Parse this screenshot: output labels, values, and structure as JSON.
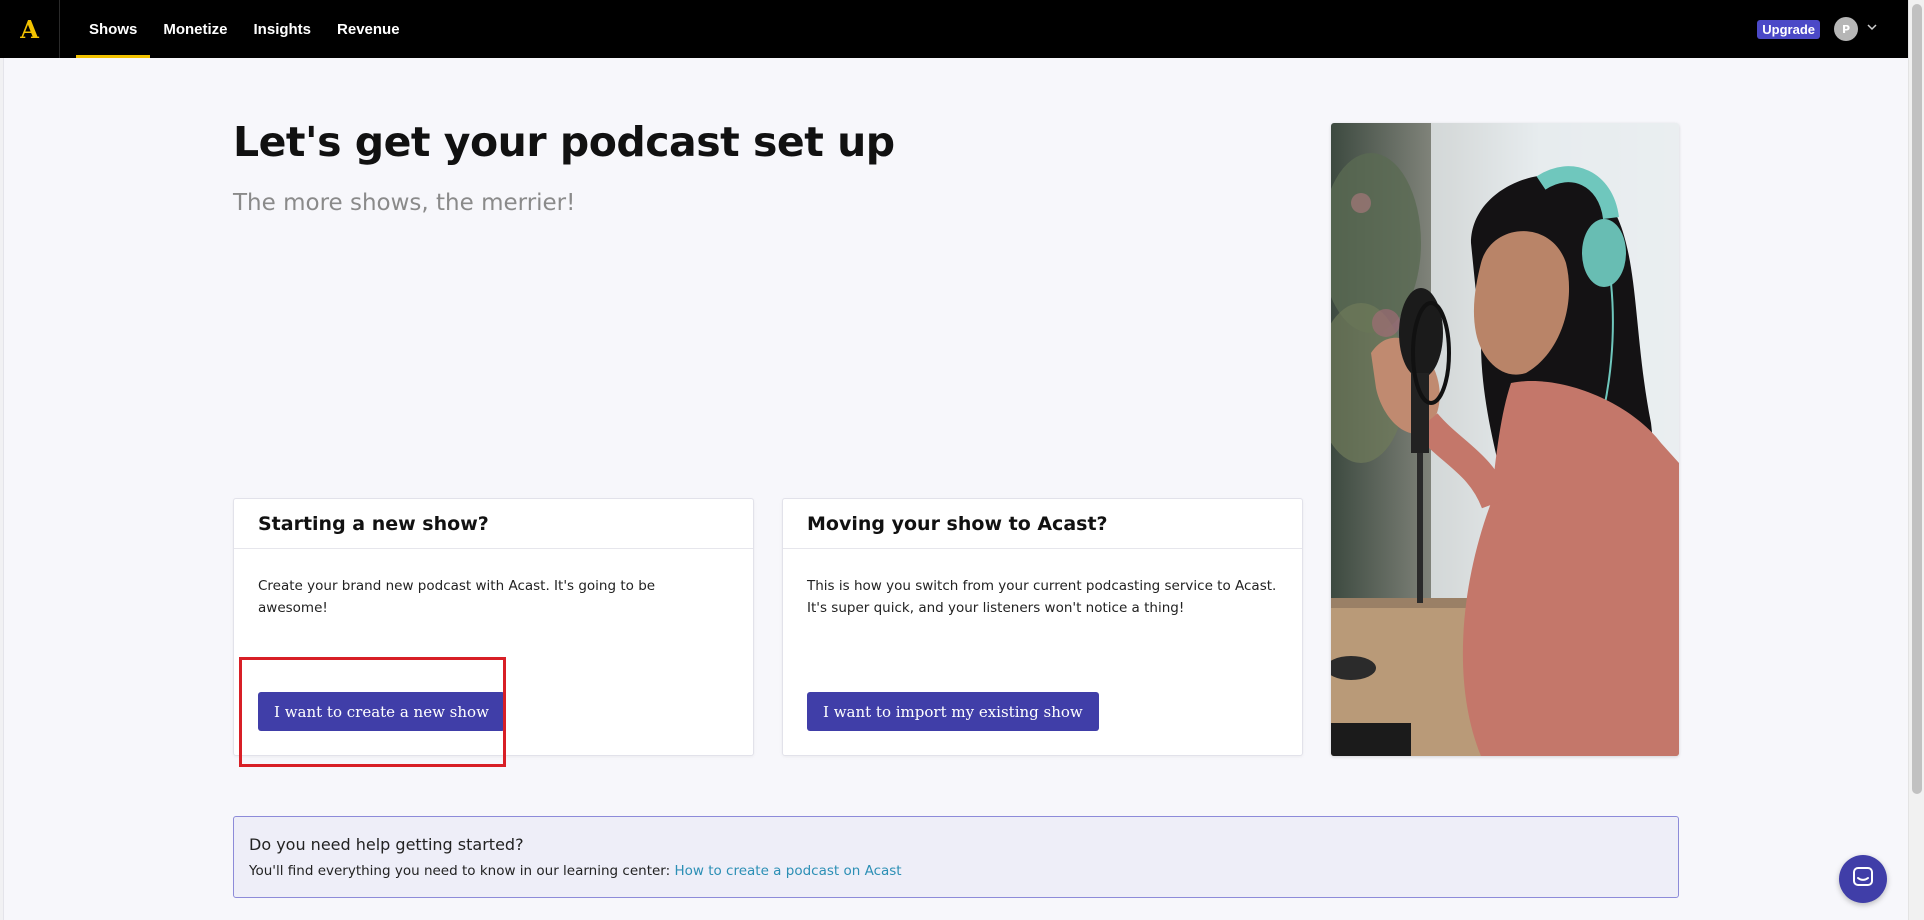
{
  "nav": {
    "logo": "A",
    "items": [
      {
        "label": "Shows",
        "active": true
      },
      {
        "label": "Monetize",
        "active": false
      },
      {
        "label": "Insights",
        "active": false
      },
      {
        "label": "Revenue",
        "active": false
      }
    ],
    "upgrade": "Upgrade",
    "avatar_initial": "P",
    "chevron": "⌄"
  },
  "hero": {
    "title": "Let's get your podcast set up",
    "subtitle": "The more shows, the merrier!"
  },
  "cards": [
    {
      "title": "Starting a new show?",
      "body": "Create your brand new podcast with Acast. It's going to be awesome!",
      "button": "I want to create a new show"
    },
    {
      "title": "Moving your show to Acast?",
      "body": "This is how you switch from your current podcasting service to Acast. It's super quick, and your listeners won't notice a thing!",
      "button": "I want to import my existing show"
    }
  ],
  "help": {
    "title": "Do you need help getting started?",
    "text": "You'll find everything you need to know in our learning center: ",
    "link": "How to create a podcast on Acast"
  },
  "colors": {
    "brand_yellow": "#f2c200",
    "primary": "#403ea8",
    "upgrade": "#4b49c7",
    "highlight": "#d81f26",
    "link": "#2c8fb5"
  },
  "icons": {
    "chat": "chat-bubble-icon"
  }
}
